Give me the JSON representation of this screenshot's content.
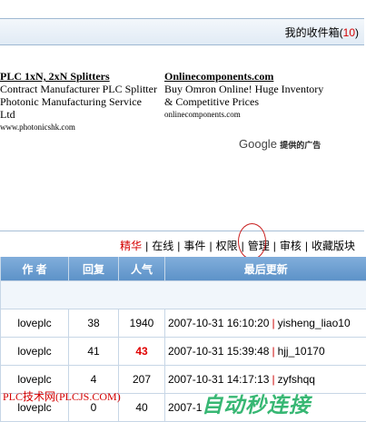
{
  "inbox": {
    "label": "我的收件箱",
    "open": "(",
    "count": "10",
    "close": ")"
  },
  "ads": [
    {
      "title": "PLC 1xN, 2xN Splitters",
      "lines": [
        "Contract Manufacturer PLC Splitter",
        "Photonic Manufacturing Service Ltd"
      ],
      "url": "www.photonicshk.com"
    },
    {
      "title": "Onlinecomponents.com",
      "lines": [
        "Buy Omron Online! Huge Inventory",
        "& Competitive Prices"
      ],
      "url": "onlinecomponents.com"
    }
  ],
  "google": {
    "word": "Google",
    "label": "提供的广告"
  },
  "toolbar": {
    "items": [
      "精华",
      "在线",
      "事件",
      "权限",
      "管理",
      "审核",
      "收藏版块"
    ],
    "sep": "|"
  },
  "table": {
    "headers": [
      "作 者",
      "回复",
      "人气",
      "最后更新"
    ],
    "rows": [
      {
        "author": "loveplc",
        "replies": "38",
        "views": "1940",
        "hot": false,
        "time": "2007-10-31 16:10:20",
        "user": "yisheng_liao10"
      },
      {
        "author": "loveplc",
        "replies": "41",
        "views": "43",
        "hot": true,
        "time": "2007-10-31 15:39:48",
        "user": "hjj_10170"
      },
      {
        "author": "loveplc",
        "replies": "4",
        "views": "207",
        "hot": false,
        "time": "2007-10-31 14:17:13",
        "user": "zyfshqq"
      },
      {
        "author": "loveplc",
        "replies": "0",
        "views": "40",
        "hot": false,
        "time": "2007-1",
        "user": ""
      }
    ]
  },
  "watermark": {
    "left": "PLC技术网(PLCJS.COM)",
    "right": "自动秒连接"
  }
}
